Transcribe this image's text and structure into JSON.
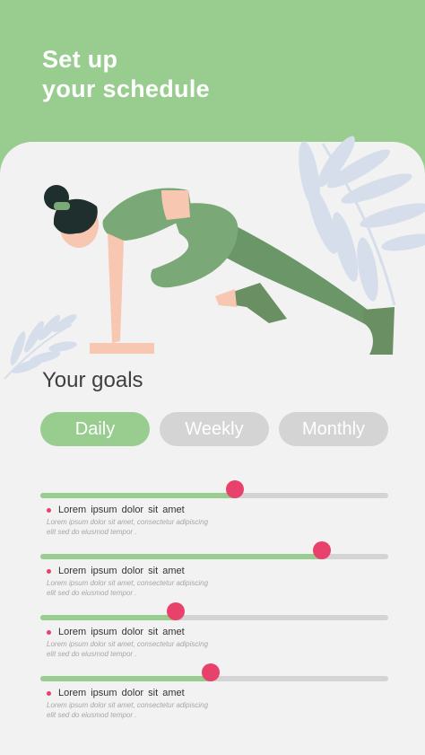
{
  "header": {
    "title_line1": "Set up",
    "title_line2": "your schedule",
    "background_color": "#98cd8f"
  },
  "goals": {
    "title": "Your goals",
    "tabs": [
      {
        "label": "Daily",
        "active": true
      },
      {
        "label": "Weekly",
        "active": false
      },
      {
        "label": "Monthly",
        "active": false
      }
    ]
  },
  "sliders": [
    {
      "label": "Lorem  ipsum  dolor sit amet",
      "description_line1": "Lorem  ipsum  dolor sit amet, consectetur adipiscing",
      "description_line2": "elit sed do eiusmod tempor .",
      "value": 0.56
    },
    {
      "label": "Lorem  ipsum  dolor sit amet",
      "description_line1": "Lorem  ipsum  dolor sit amet, consectetur adipiscing",
      "description_line2": "elit sed do eiusmod tempor .",
      "value": 0.81
    },
    {
      "label": "Lorem  ipsum  dolor sit amet",
      "description_line1": "Lorem  ipsum  dolor sit amet, consectetur adipiscing",
      "description_line2": "elit sed do eiusmod tempor .",
      "value": 0.39
    },
    {
      "label": "Lorem  ipsum  dolor sit amet",
      "description_line1": "Lorem  ipsum  dolor sit amet, consectetur adipiscing",
      "description_line2": "elit sed do eiusmod tempor .",
      "value": 0.49
    }
  ],
  "colors": {
    "accent_green": "#98cd8f",
    "thumb_pink": "#e8416c",
    "inactive_gray": "#d4d4d4"
  },
  "icons": [
    "leaf-icon",
    "exercise-illustration"
  ]
}
